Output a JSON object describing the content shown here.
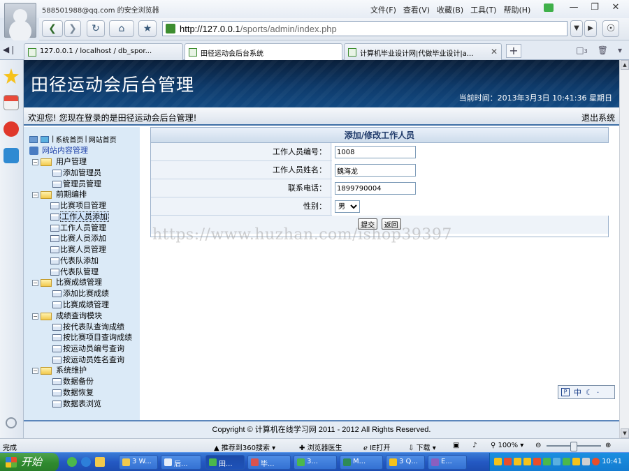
{
  "browser": {
    "account": "588501988@qq.com 的安全浏览器",
    "menu": [
      "文件(F)",
      "查看(V)",
      "收藏(B)",
      "工具(T)",
      "帮助(H)"
    ],
    "url_host": "http://127.0.0.1",
    "url_path": "/sports/admin/index.php",
    "tabs": [
      {
        "label": "127.0.0.1 / localhost / db_spor..."
      },
      {
        "label": "田径运动会后台系统"
      },
      {
        "label": "计算机毕业设计网|代做毕业设计|a..."
      }
    ],
    "tab_count": "3"
  },
  "header": {
    "title": "田径运动会后台管理",
    "time": "当前时间：2013年3月3日  10:41:36 星期日"
  },
  "welcome": {
    "text": "欢迎您! 您现在登录的是田径运动会后台管理!",
    "logout": "退出系统"
  },
  "topnav": {
    "home": "系统首页",
    "site": "网站首页"
  },
  "tree": {
    "root": "网站内容管理",
    "groups": [
      {
        "label": "用户管理",
        "items": [
          "添加管理员",
          "管理员管理"
        ]
      },
      {
        "label": "前期编排",
        "items": [
          "比赛项目管理",
          "工作人员添加",
          "工作人员管理",
          "比赛人员添加",
          "比赛人员管理",
          "代表队添加",
          "代表队管理"
        ]
      },
      {
        "label": "比赛成绩管理",
        "items": [
          "添加比赛成绩",
          "比赛成绩管理"
        ]
      },
      {
        "label": "成绩查询模块",
        "items": [
          "按代表队查询成绩",
          "按比赛项目查询成绩",
          "按运动员编号查询",
          "按运动员姓名查询"
        ]
      },
      {
        "label": "系统维护",
        "items": [
          "数据备份",
          "数据恢复",
          "数据表浏览"
        ]
      }
    ]
  },
  "form": {
    "title": "添加/修改工作人员",
    "fields": [
      {
        "label": "工作人员编号：",
        "value": "1008"
      },
      {
        "label": "工作人员姓名：",
        "value": "魏海龙"
      },
      {
        "label": "联系电话：",
        "value": "1899790004"
      }
    ],
    "gender_label": "性别：",
    "gender_value": "男",
    "submit": "提交",
    "back": "返回"
  },
  "watermark": "https://www.huzhan.com/ishop39397",
  "ime": "中",
  "footer": "Copyright © 计算机在线学习网  2011 - 2012 All Rights Reserved.",
  "status": {
    "done": "完成",
    "recommend": "推荐到360搜索",
    "doctor": "浏览器医生",
    "ie": "IE打开",
    "download": "下载",
    "zoom": "100%"
  },
  "taskbar": {
    "start": "开始",
    "tasks": [
      "3 W...",
      "后...",
      "田...",
      "毕...",
      "3...",
      "M...",
      "3 Q...",
      "E..."
    ],
    "clock": "10:41"
  },
  "colors": {
    "header_bg": "#0e3a6a",
    "nav_bg": "#dbeaf7",
    "taskbar": "#2459c3"
  }
}
